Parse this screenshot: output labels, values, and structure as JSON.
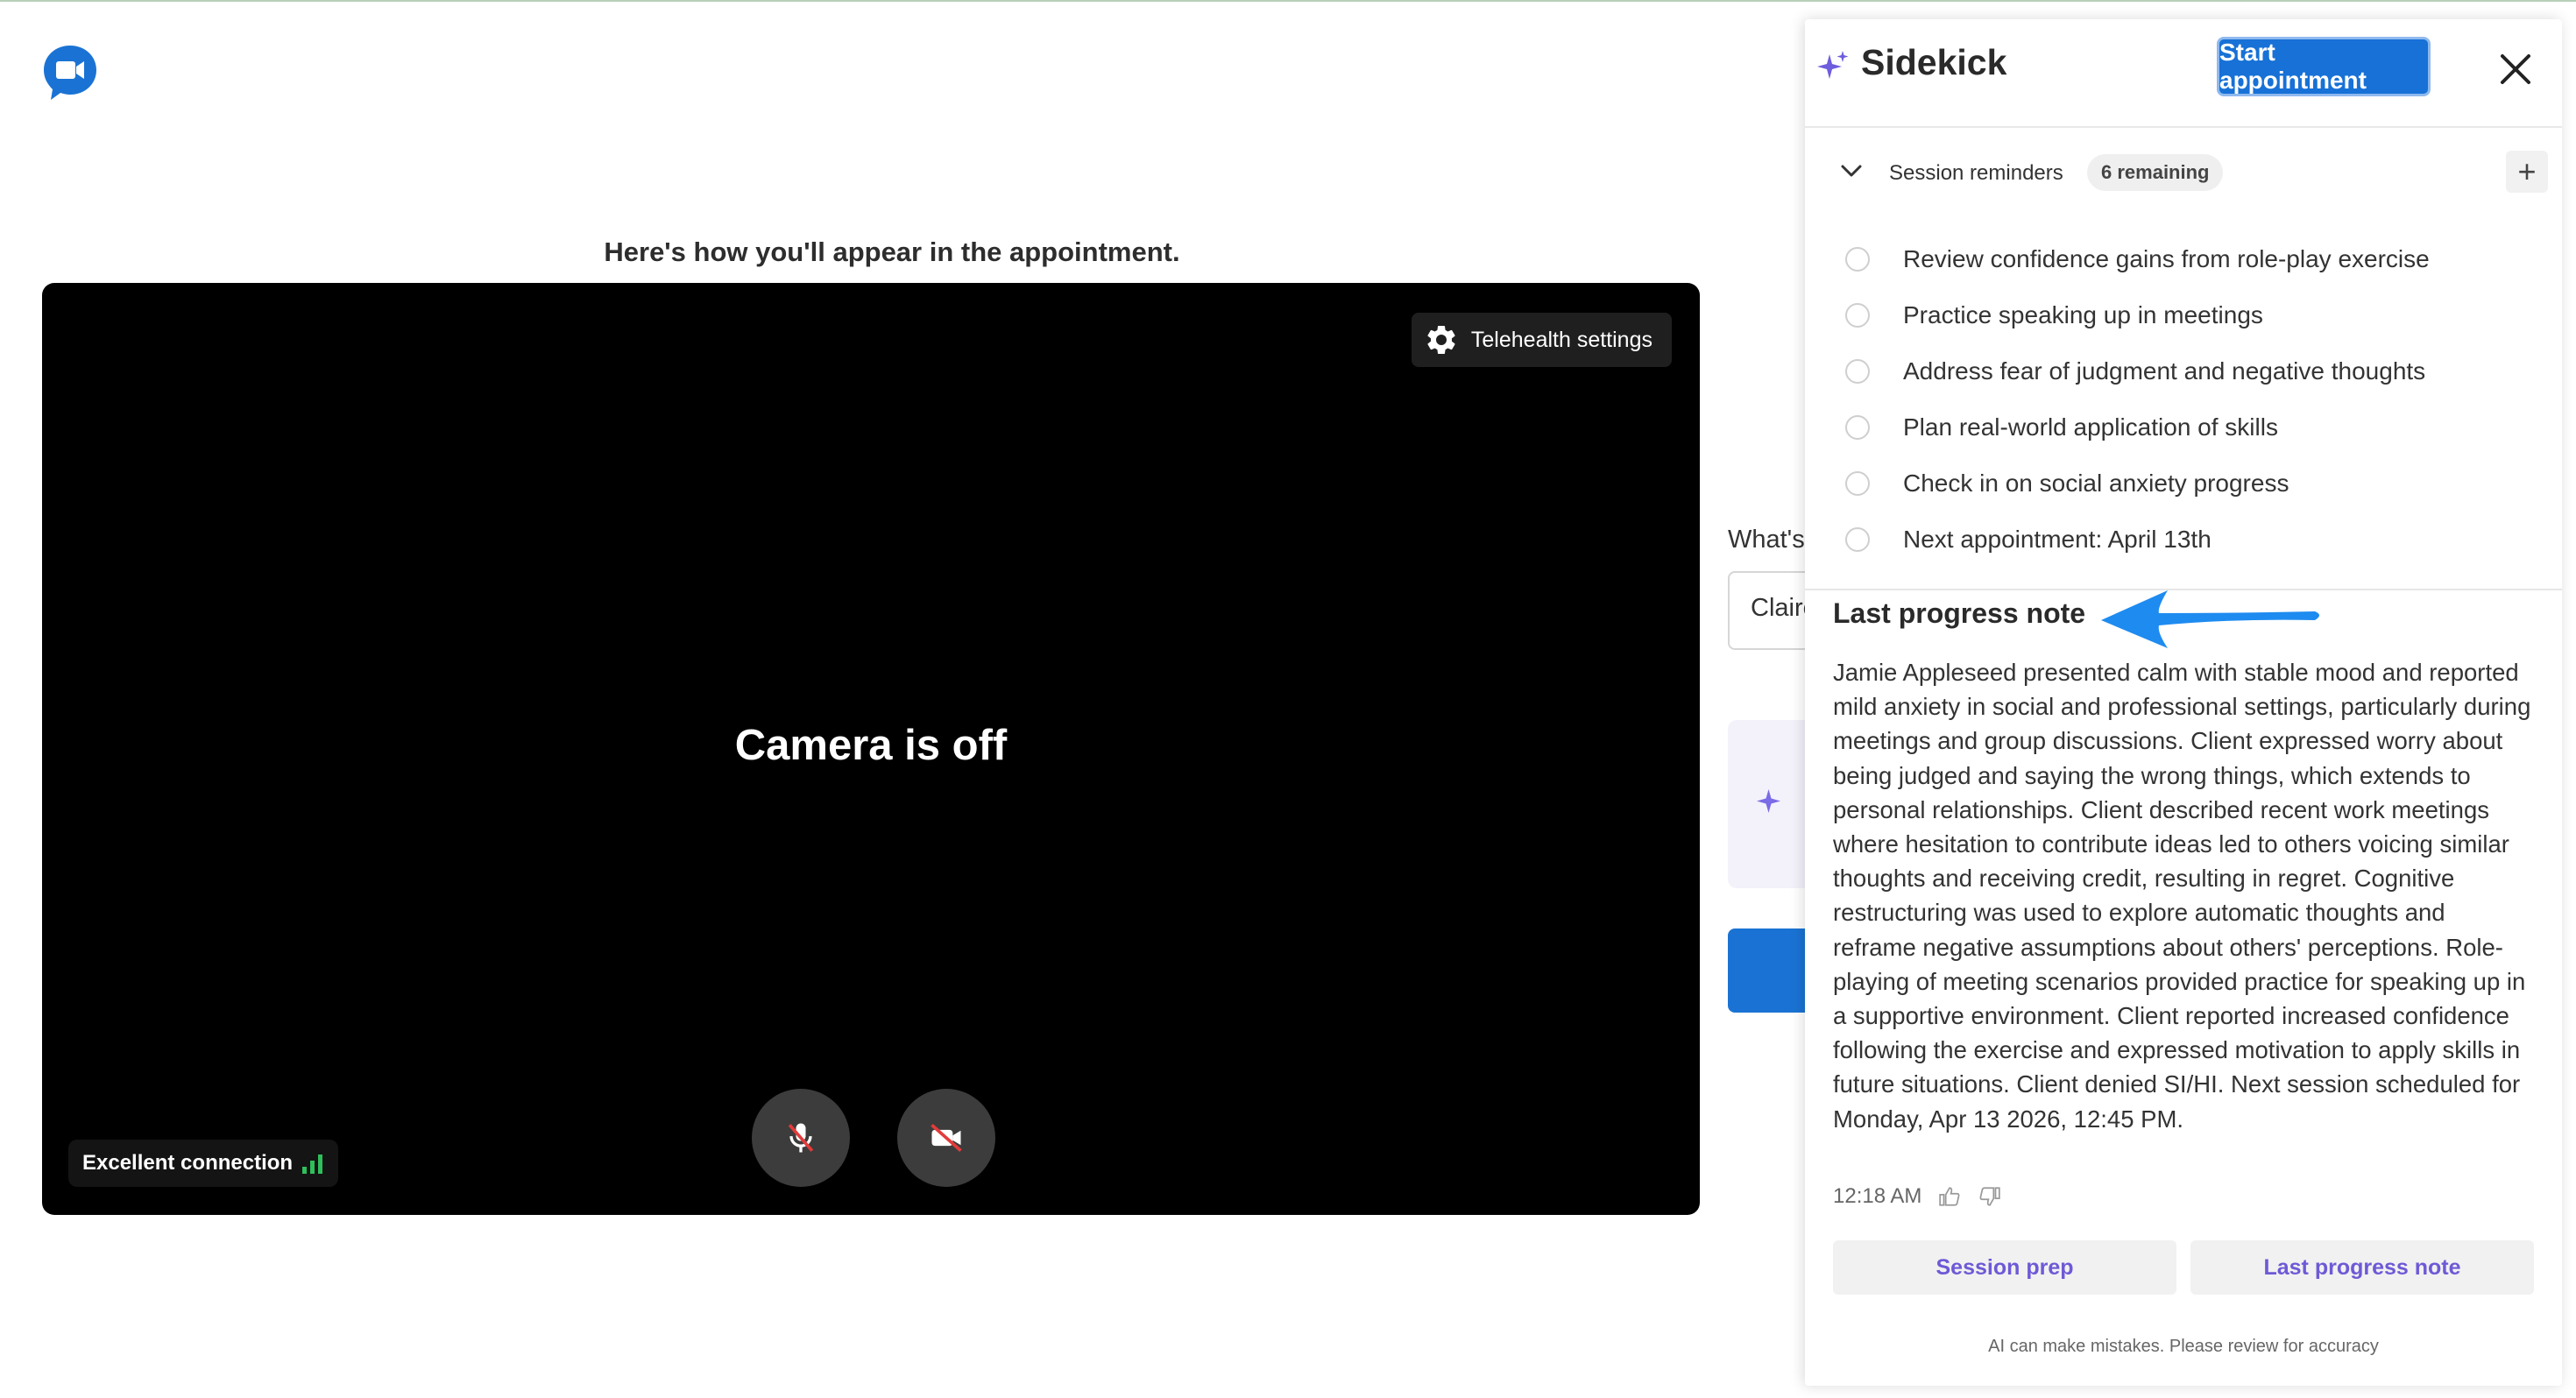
{
  "app": {
    "logo_icon": "video-chat-icon",
    "accent": "#1771d6"
  },
  "preview": {
    "title": "Here's how you'll appear in the appointment.",
    "camera_status": "Camera is off",
    "telehealth_settings_label": "Telehealth settings",
    "connection_label": "Excellent connection",
    "mic_icon": "mic-off-icon",
    "camera_icon": "camera-off-icon"
  },
  "join_form": {
    "name_label": "What's",
    "name_value": "Claire"
  },
  "sidekick": {
    "title": "Sidekick",
    "start_button": "Start appointment",
    "reminders": {
      "label": "Session reminders",
      "badge": "6 remaining",
      "items": [
        "Review confidence gains from role-play exercise",
        "Practice speaking up in meetings",
        "Address fear of judgment and negative thoughts",
        "Plan real-world application of skills",
        "Check in on social anxiety progress",
        "Next appointment: April 13th"
      ]
    },
    "progress_note": {
      "title": "Last progress note",
      "body": "Jamie Appleseed presented calm with stable mood and reported mild anxiety in social and professional settings, particularly during meetings and group discussions. Client expressed worry about being judged and saying the wrong things, which extends to personal relationships. Client described recent work meetings where hesitation to contribute ideas led to others voicing similar thoughts and receiving credit, resulting in regret. Cognitive restructuring was used to explore automatic thoughts and reframe negative assumptions about others' perceptions. Role-playing of meeting scenarios provided practice for speaking up in a supportive environment. Client reported increased confidence following the exercise and expressed motivation to apply skills in future situations. Client denied SI/HI. Next session scheduled for Monday, Apr 13 2026, 12:45 PM.",
      "time": "12:18 AM"
    },
    "tabs": [
      "Session prep",
      "Last progress note"
    ],
    "disclaimer": "AI can make mistakes. Please review for accuracy"
  }
}
